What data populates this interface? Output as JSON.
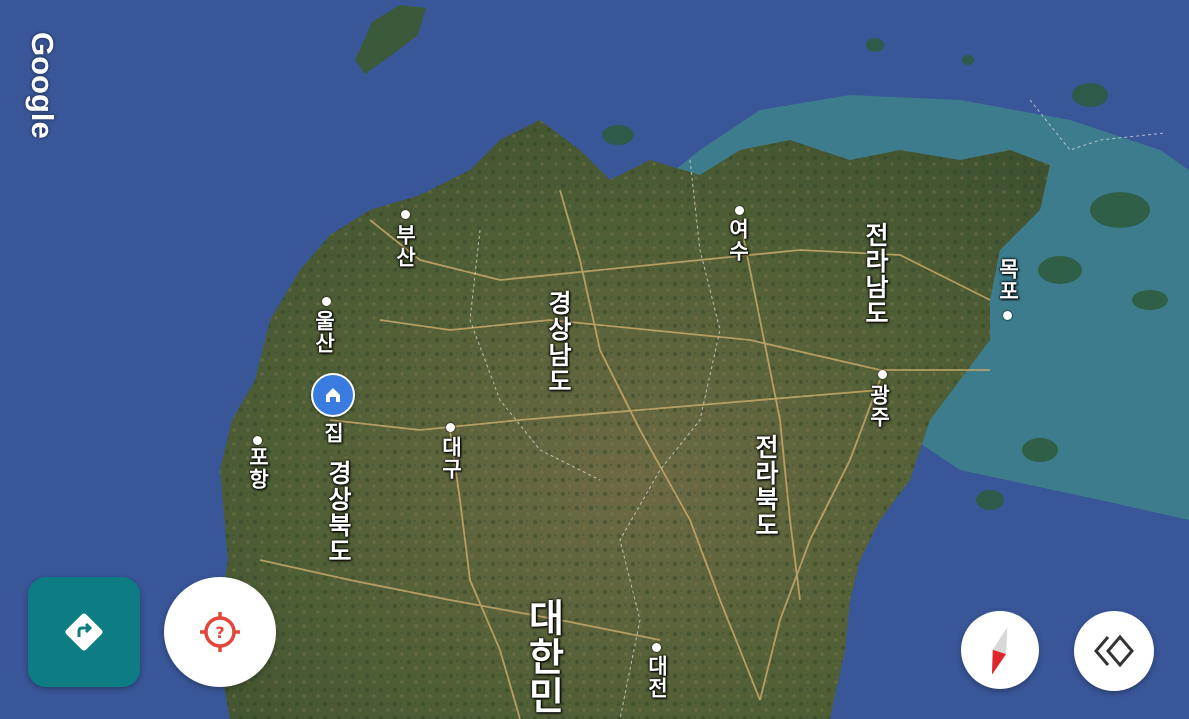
{
  "map": {
    "watermark": "Google",
    "country_label": "대한민",
    "provinces": {
      "gyeongsangnam": "경상남도",
      "gyeongsangbuk": "경상북도",
      "jeollanam": "전라남도",
      "jeollabuk": "전라북도"
    },
    "cities": {
      "busan": "부산",
      "ulsan": "울산",
      "pohang": "포항",
      "daegu": "대구",
      "yeosu": "여수",
      "gwangju": "광주",
      "mokpo": "목포",
      "daejeon": "대전"
    },
    "home_pin_label": "집"
  },
  "controls": {
    "navigate_icon": "directions-icon",
    "location_icon": "my-location-icon",
    "compass_icon": "compass-icon",
    "layers_icon": "layers-icon"
  },
  "colors": {
    "sea": "#3d5a9c",
    "land": "#5f6b3e",
    "shallow_water": "#3e8a88",
    "nav_button": "#0e7d83",
    "location_accent": "#e4463a",
    "home_pin": "#3a7be0"
  }
}
